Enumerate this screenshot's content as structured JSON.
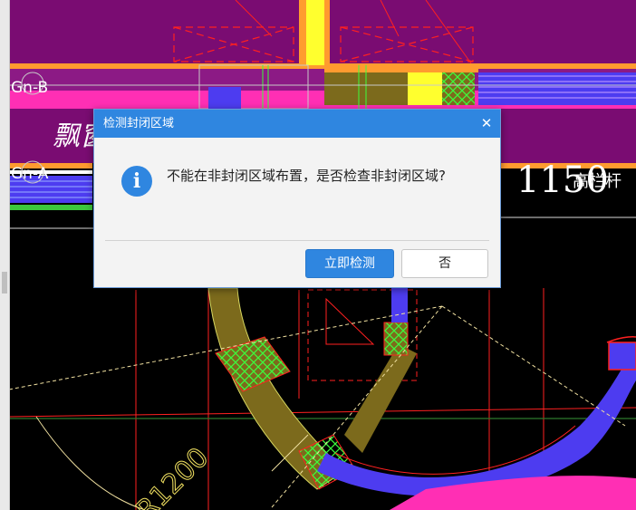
{
  "canvas": {
    "labels": {
      "grid_b": "Gn-B",
      "grid_a": "Gn-A",
      "window_label": "飘窗",
      "dim_1150": "1150",
      "dim_1150_suffix": "高栏杆",
      "radius": "R1200"
    },
    "colors": {
      "background": "#000000",
      "magenta": "#7a0c72",
      "pink": "#ff2fb4",
      "orange": "#ff9b2f",
      "yellow": "#ffff2e",
      "blue": "#4d3cf0",
      "olive": "#7c6a1c",
      "green": "#3cff3c",
      "red": "#ff2020"
    }
  },
  "dialog": {
    "title": "检测封闭区域",
    "close_glyph": "✕",
    "icon": "info-icon",
    "icon_glyph": "i",
    "message": "不能在非封闭区域布置，是否检查非封闭区域?",
    "buttons": {
      "primary": "立即检测",
      "secondary": "否"
    },
    "colors": {
      "title_bar": "#2f86e0",
      "primary_button": "#2f86e0",
      "body": "#f3f3f3"
    }
  }
}
